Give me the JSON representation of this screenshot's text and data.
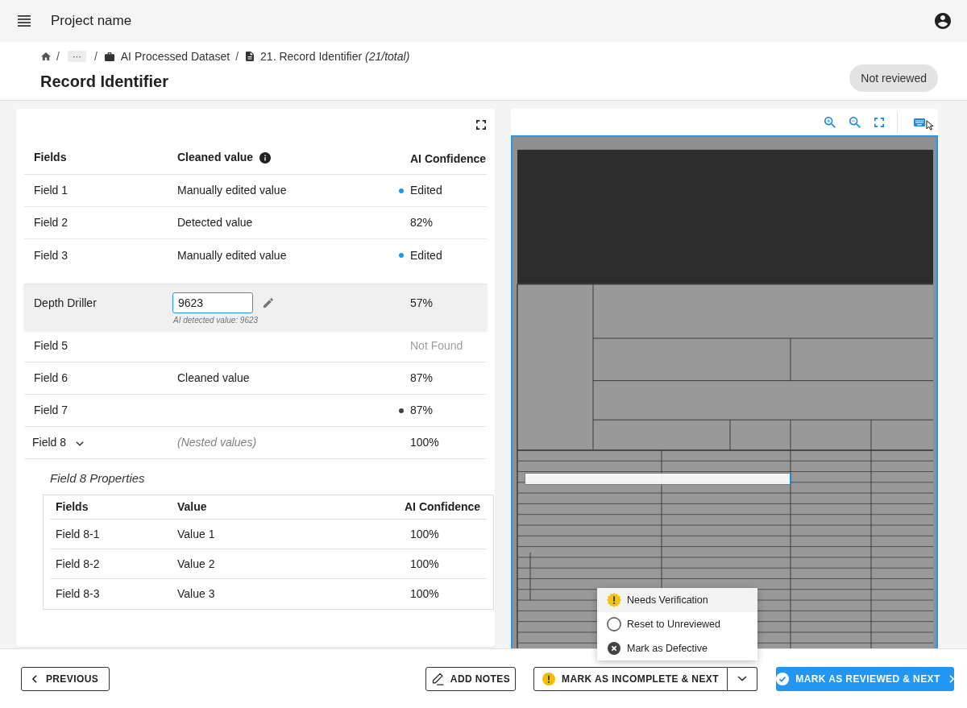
{
  "app_bar": {
    "title": "Project name"
  },
  "breadcrumbs": {
    "separator": "/",
    "items": [
      {
        "kind": "home"
      },
      {
        "kind": "more",
        "label": "···"
      },
      {
        "kind": "dataset",
        "label": "AI Processed Dataset"
      },
      {
        "kind": "record",
        "label": "21. Record Identifier *(21/total)*"
      }
    ]
  },
  "page": {
    "title": "Record Identifier",
    "status": "Not reviewed"
  },
  "fields_table": {
    "columns": [
      {
        "label": "Fields"
      },
      {
        "label": "Cleaned value",
        "info": true
      },
      {
        "label": "AI Confidence"
      }
    ],
    "rows": [
      {
        "field": "Field 1",
        "kind": "text",
        "value": "Manually edited value",
        "confidence": "Edited",
        "found": true,
        "color": "#2196f3",
        "selected": false
      },
      {
        "field": "Field 2",
        "kind": "text",
        "value": "Detected value",
        "confidence": "82%",
        "found": true,
        "selected": false
      },
      {
        "field": "Field 3",
        "kind": "text",
        "value": "Manually edited value",
        "confidence": "Edited",
        "found": true,
        "color": "#2196f3",
        "selected": false
      },
      {
        "field": "Depth Driller",
        "kind": "input",
        "value": "9623",
        "hint": "AI detected value: 9623",
        "confidence": "57%",
        "found": true,
        "selected": true
      },
      {
        "field": "Field 5",
        "kind": "text",
        "confidence": "Not Found",
        "found": false,
        "selected": false
      },
      {
        "field": "Field 6",
        "kind": "text",
        "value": "Cleaned value",
        "confidence": "87%",
        "found": true,
        "selected": false
      },
      {
        "field": "Field 7",
        "kind": "text",
        "confidence": "87%",
        "found": true,
        "color": "#424242",
        "selected": false
      },
      {
        "field": "Field 8",
        "kind": "nested",
        "value": "(Nested values)",
        "confidence": "100%",
        "found": true,
        "selected": false,
        "expanded": true,
        "children": {
          "title": "Field 8 Properties",
          "columns": [
            "Fields",
            "Value",
            "AI Confidence"
          ],
          "rows": [
            {
              "field": "Field 8-1",
              "value": "Value 1",
              "confidence": "100%"
            },
            {
              "field": "Field 8-2",
              "value": "Value 2",
              "confidence": "100%"
            },
            {
              "field": "Field 8-3",
              "value": "Value 3",
              "confidence": "100%"
            }
          ]
        }
      }
    ]
  },
  "footer": {
    "previous": "PREVIOUS",
    "add_notes": "ADD NOTES",
    "incomplete": {
      "label": "MARK AS INCOMPLETE & NEXT",
      "expanded": true,
      "menu": [
        {
          "label": "Needs Verification",
          "kind": "warning",
          "selected": true
        },
        {
          "label": "Reset to Unreviewed",
          "kind": "reset",
          "selected": false
        },
        {
          "label": "Mark as Defective",
          "kind": "defective",
          "selected": false
        }
      ]
    },
    "reviewed": "MARK AS REVIEWED & NEXT"
  }
}
